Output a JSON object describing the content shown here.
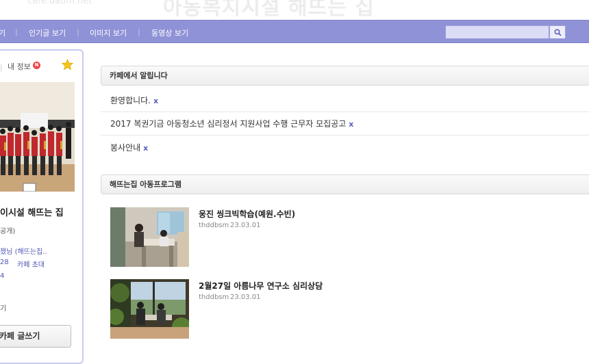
{
  "header": {
    "title": "아동복지시설 해뜨는 집",
    "faint_left": "cafe.daum.net"
  },
  "nav": {
    "items": [
      {
        "label": "기"
      },
      {
        "label": "인기글 보기"
      },
      {
        "label": "이미지 보기"
      },
      {
        "label": "동영상 보기"
      }
    ],
    "separator": "|",
    "search_placeholder": ""
  },
  "sidebar": {
    "my_info": "내 정보",
    "new_badge": "N",
    "divider": "|",
    "cafe_name": "이시설 해뜨는 집",
    "public": "공개)",
    "host": "챘님 (해뜨는집..",
    "member_count": "28",
    "invite": "카페 초대",
    "number": "4",
    "misc": "기",
    "write_button": "카페 글쓰기"
  },
  "notices": {
    "heading": "카페에서 알립니다",
    "items": [
      {
        "text": "환영합니다.",
        "mark": "x"
      },
      {
        "text": "2017 복권기금 아동청소년 심리정서 지원사업 수행 근무자 모집공고",
        "mark": "x"
      },
      {
        "text": "봉사안내",
        "mark": "x"
      }
    ]
  },
  "programs": {
    "heading": "해뜨는집 아동프로그램",
    "posts": [
      {
        "title": "웅진 씽크빅학습(예원.수빈)",
        "author": "thddbsm",
        "date": "23.03.01"
      },
      {
        "title": "2월27일 아름나무 연구소 심리상담",
        "author": "thddbsm",
        "date": "23.03.01"
      }
    ]
  },
  "colors": {
    "nav_bg": "#8f92d6",
    "link": "#5055b5",
    "sidebar_border": "#c9cbee"
  }
}
